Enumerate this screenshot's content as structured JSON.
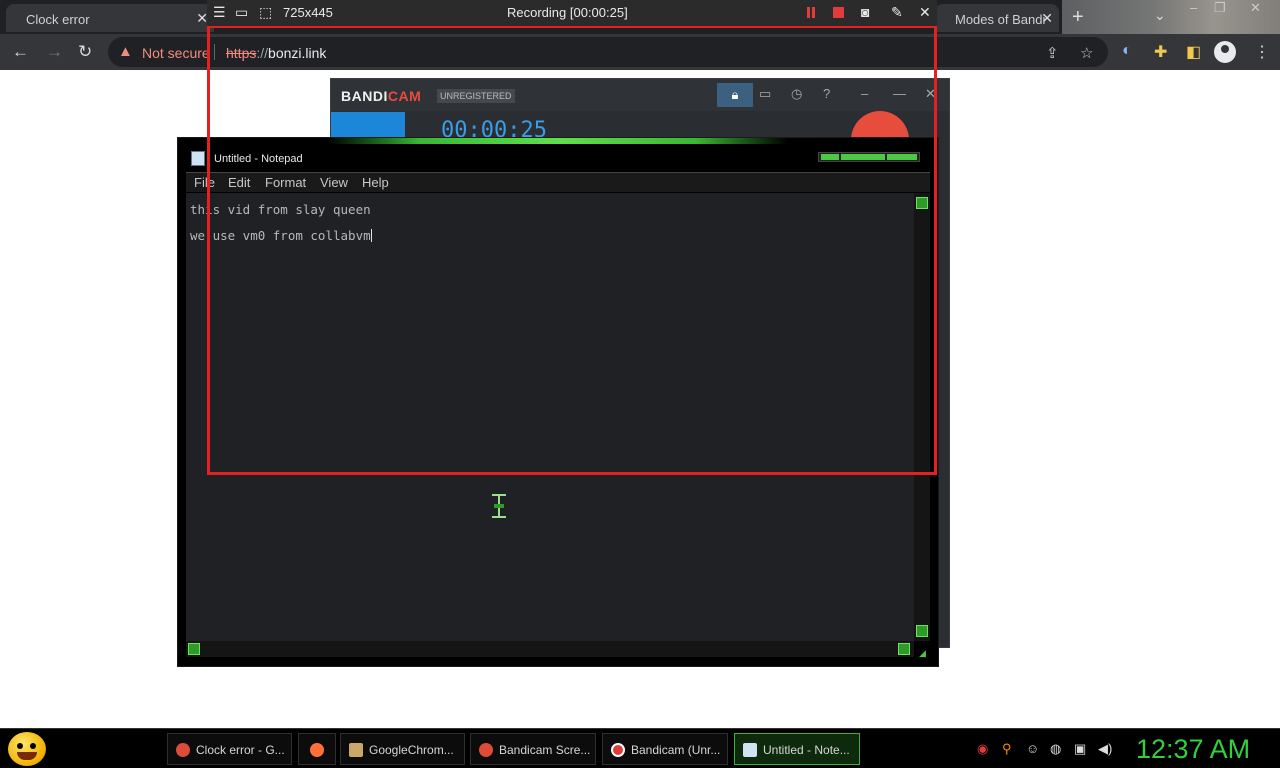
{
  "browser": {
    "tabs": [
      {
        "title": "Clock error",
        "close": "✕"
      },
      {
        "title": "Modes of Bandi",
        "close": "✕"
      }
    ],
    "new_tab": "+",
    "tab_search": "⌄",
    "window_controls": [
      "–",
      "❐",
      "✕"
    ],
    "security_label": "Not secure",
    "url_scheme": "https",
    "url_sep": "://",
    "url_host": "bonzi.link"
  },
  "capture_bar": {
    "size": "725x445",
    "status": "Recording [00:00:25]"
  },
  "bandicam": {
    "logo_main": "BANDI",
    "logo_cam": "CAM",
    "unregistered": "UNREGISTERED",
    "timer": "00:00:25"
  },
  "notepad": {
    "title": "Untitled - Notepad",
    "menu": [
      "File",
      "Edit",
      "Format",
      "View",
      "Help"
    ],
    "lines": [
      "this vid from slay queen",
      "we use vm0 from collabvm"
    ]
  },
  "taskbar": {
    "buttons": [
      {
        "label": "Clock error - G...",
        "color": "#dd4b39"
      },
      {
        "label": "",
        "color": "#ff7139"
      },
      {
        "label": "GoogleChrom...",
        "color": "#c9a86a"
      },
      {
        "label": "Bandicam Scre...",
        "color": "#dd4b39"
      },
      {
        "label": "Bandicam (Unr...",
        "color": "#e23b3b"
      },
      {
        "label": "Untitled - Note...",
        "color": "#cfe3f1"
      }
    ],
    "clock": "12:37 AM"
  },
  "colors": {
    "accent_green": "#2fd23b",
    "record_red": "#e52020",
    "chrome_dark": "#35363a"
  }
}
